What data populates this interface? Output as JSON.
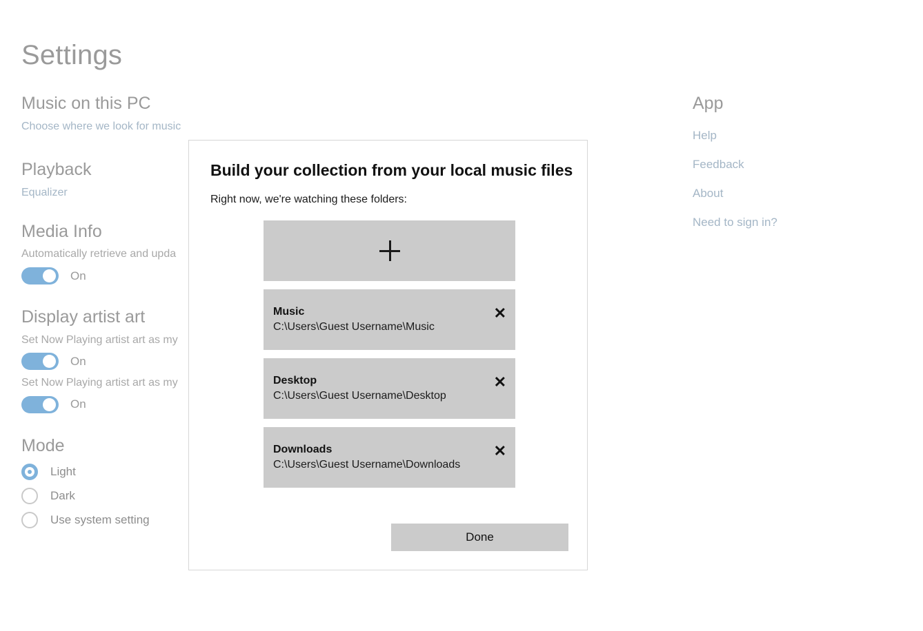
{
  "page": {
    "title": "Settings"
  },
  "settings": {
    "sections": [
      {
        "heading": "Music on this PC",
        "link": "Choose where we look for music"
      },
      {
        "heading": "Playback",
        "link": "Equalizer"
      },
      {
        "heading": "Media Info",
        "desc": "Automatically retrieve and upda",
        "toggle_label": "On"
      },
      {
        "heading": "Display artist art",
        "desc1": "Set Now Playing artist art as my",
        "toggle1_label": "On",
        "desc2": "Set Now Playing artist art as my",
        "toggle2_label": "On"
      },
      {
        "heading": "Mode",
        "options": [
          {
            "label": "Light",
            "selected": true
          },
          {
            "label": "Dark",
            "selected": false
          },
          {
            "label": "Use system setting",
            "selected": false
          }
        ]
      }
    ]
  },
  "app": {
    "heading": "App",
    "links": [
      "Help",
      "Feedback",
      "About",
      "Need to sign in?"
    ]
  },
  "dialog": {
    "title": "Build your collection from your local music files",
    "subtitle": "Right now, we're watching these folders:",
    "add_icon": "plus-icon",
    "remove_icon": "close-icon",
    "remove_glyph": "✕",
    "folders": [
      {
        "name": "Music",
        "path": "C:\\Users\\Guest Username\\Music"
      },
      {
        "name": "Desktop",
        "path": "C:\\Users\\Guest Username\\Desktop"
      },
      {
        "name": "Downloads",
        "path": "C:\\Users\\Guest Username\\Downloads"
      }
    ],
    "done_label": "Done"
  },
  "colors": {
    "accent": "#7fb2db",
    "heading": "#9a9a9a",
    "link": "#a4b6c6",
    "tile": "#cbcbcb",
    "dialog_border": "#d6d6d6"
  }
}
